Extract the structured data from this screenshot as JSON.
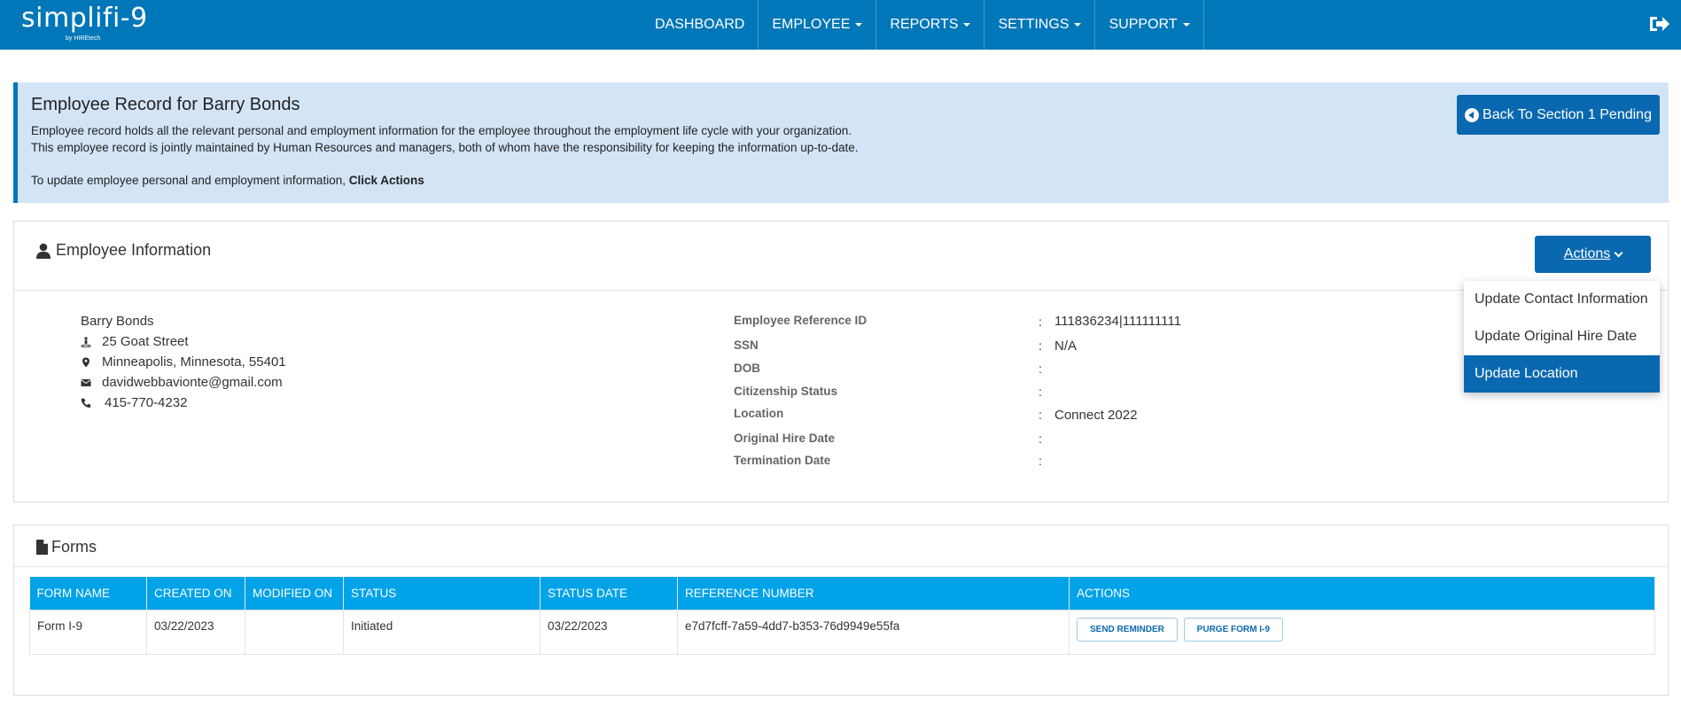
{
  "nav": {
    "logo_main": "simplifi-9",
    "logo_sub": "by HIREtech",
    "items": [
      {
        "label": "DASHBOARD"
      },
      {
        "label": "EMPLOYEE"
      },
      {
        "label": "REPORTS"
      },
      {
        "label": "SETTINGS"
      },
      {
        "label": "SUPPORT"
      }
    ]
  },
  "banner": {
    "title": "Employee Record for Barry Bonds",
    "line1": "Employee record holds all the relevant personal and employment information for the employee throughout the employment life cycle with your organization.",
    "line2": "This employee record is jointly maintained by Human Resources and managers, both of whom have the responsibility for keeping the information up-to-date.",
    "line3_prefix": "To update employee personal and employment information,",
    "line3_bold": "Click Actions",
    "back_button": "Back To Section 1 Pending"
  },
  "employee_info": {
    "title": "Employee Information",
    "actions_label": "Actions",
    "name": "Barry Bonds",
    "street": "25 Goat Street",
    "city_state": "Minneapolis, Minnesota, 55401",
    "email": "davidwebbavionte@gmail.com",
    "phone": "415-770-4232",
    "fields": [
      {
        "label": "Employee Reference ID",
        "value": "111836234|111111111"
      },
      {
        "label": "SSN",
        "value": "N/A"
      },
      {
        "label": "DOB",
        "value": ""
      },
      {
        "label": "Citizenship Status",
        "value": ""
      },
      {
        "label": "Location",
        "value": "Connect 2022"
      },
      {
        "label": "Original Hire Date",
        "value": ""
      },
      {
        "label": "Termination Date",
        "value": ""
      }
    ],
    "colon": ":"
  },
  "dropdown": {
    "items": [
      {
        "label": "Update Contact Information"
      },
      {
        "label": "Update Original Hire Date"
      },
      {
        "label": "Update Location"
      }
    ]
  },
  "forms": {
    "title": "Forms",
    "columns": [
      "FORM NAME",
      "CREATED ON",
      "MODIFIED ON",
      "STATUS",
      "STATUS DATE",
      "REFERENCE NUMBER",
      "ACTIONS"
    ],
    "rows": [
      {
        "form_name": "Form I-9",
        "created_on": "03/22/2023",
        "modified_on": "",
        "status": "Initiated",
        "status_date": "03/22/2023",
        "reference_number": "e7d7fcff-7a59-4dd7-b353-76d9949e55fa",
        "actions": [
          "SEND REMINDER",
          "PURGE FORM I-9"
        ]
      }
    ]
  },
  "colors": {
    "navbar": "#0077b8",
    "primary_button": "#0a68b0",
    "banner_bg": "#d3e4f7",
    "table_header": "#00a2e8"
  }
}
